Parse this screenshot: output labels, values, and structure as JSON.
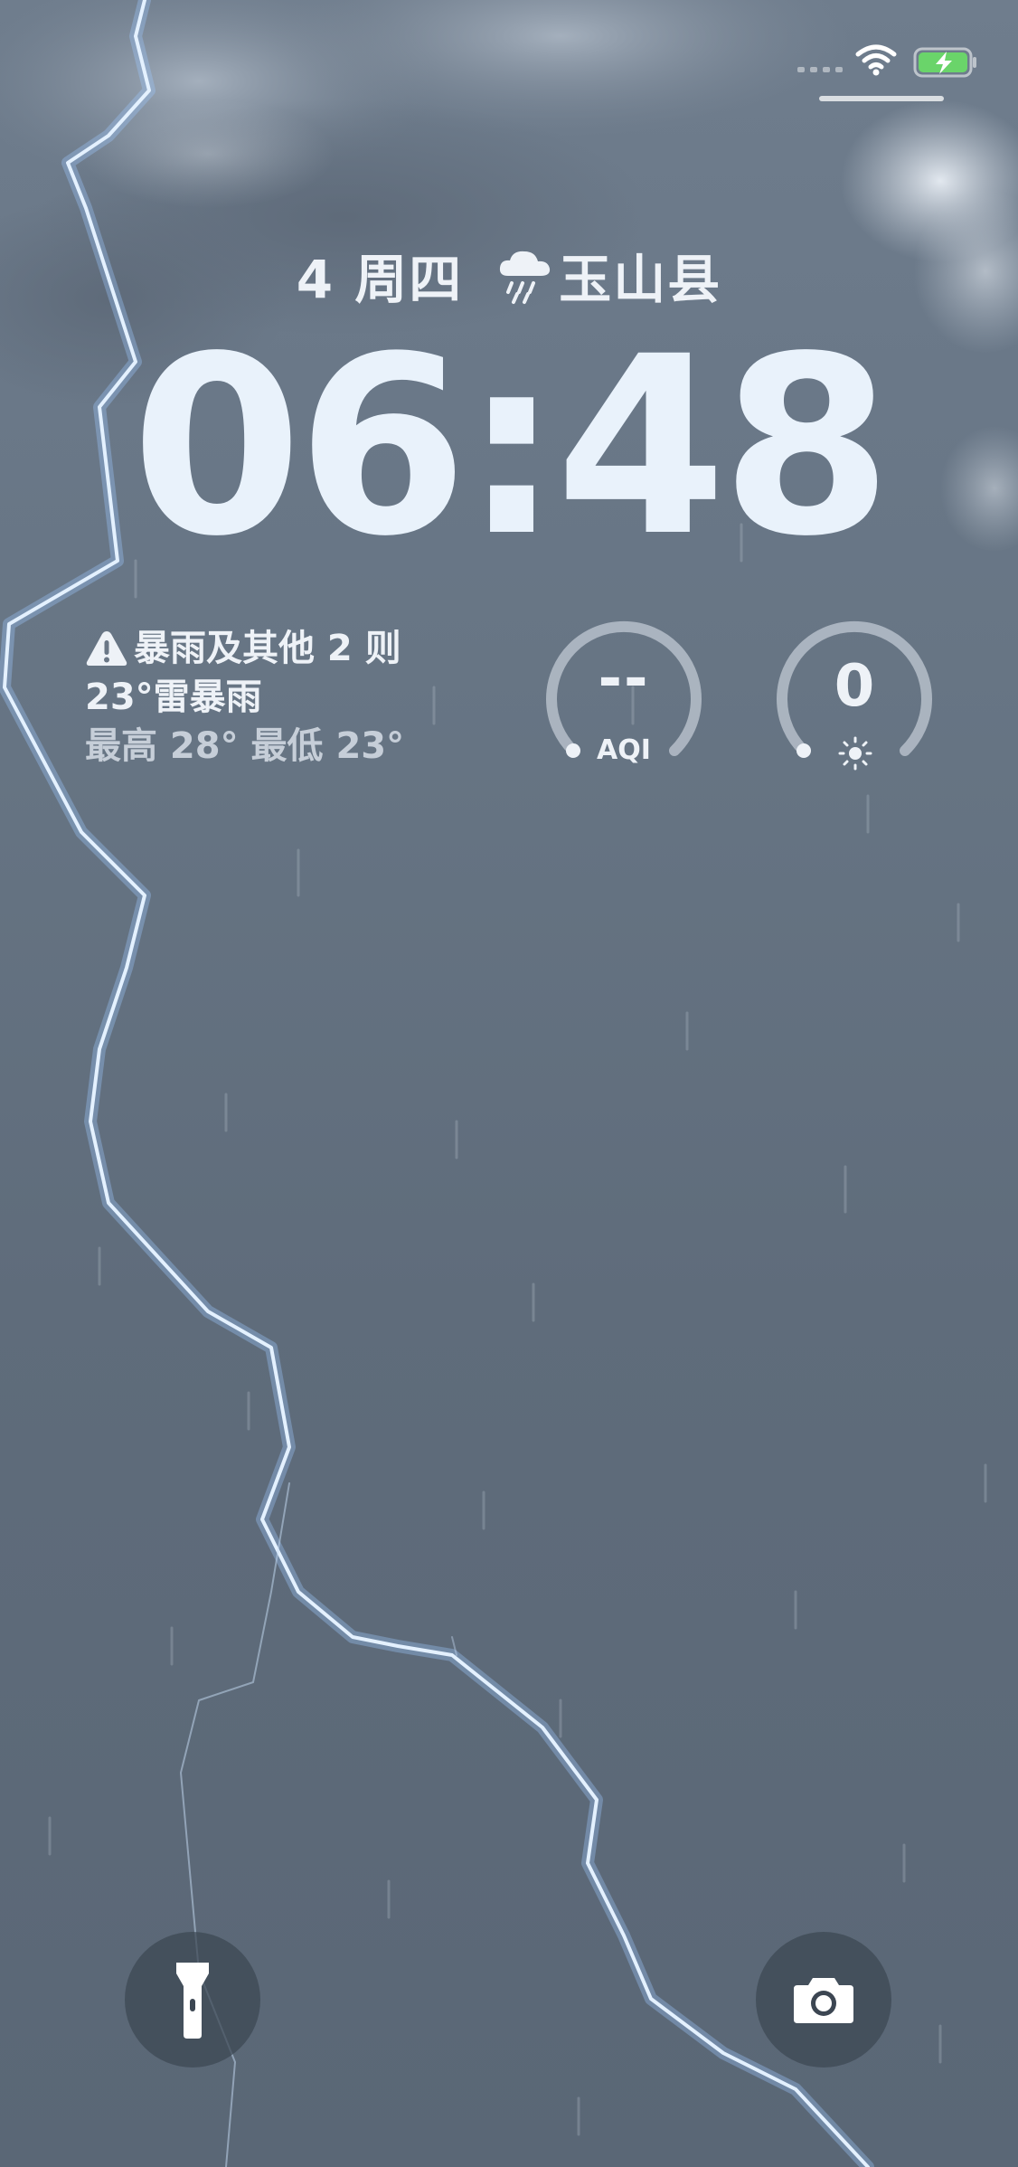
{
  "lockscreen": {
    "date": "4 周四",
    "location": "玉山县",
    "time": "06:48"
  },
  "weather_widget": {
    "alert": "暴雨及其他 2 则",
    "current": "23°雷暴雨",
    "hilo": "最高 28° 最低 23°"
  },
  "aqi_gauge": {
    "value": "--",
    "label": "AQI"
  },
  "uv_gauge": {
    "value": "0"
  },
  "icons": {
    "status": [
      "wifi-icon",
      "battery-charging-icon"
    ],
    "weather": "cloud-rain-icon",
    "alert": "warning-icon",
    "uv": "sun-icon",
    "buttons": [
      "flashlight-icon",
      "camera-icon"
    ]
  },
  "colors": {
    "battery_charge": "#6ad46a",
    "lightning": "#d8ecff",
    "text": "#eef2f7"
  }
}
